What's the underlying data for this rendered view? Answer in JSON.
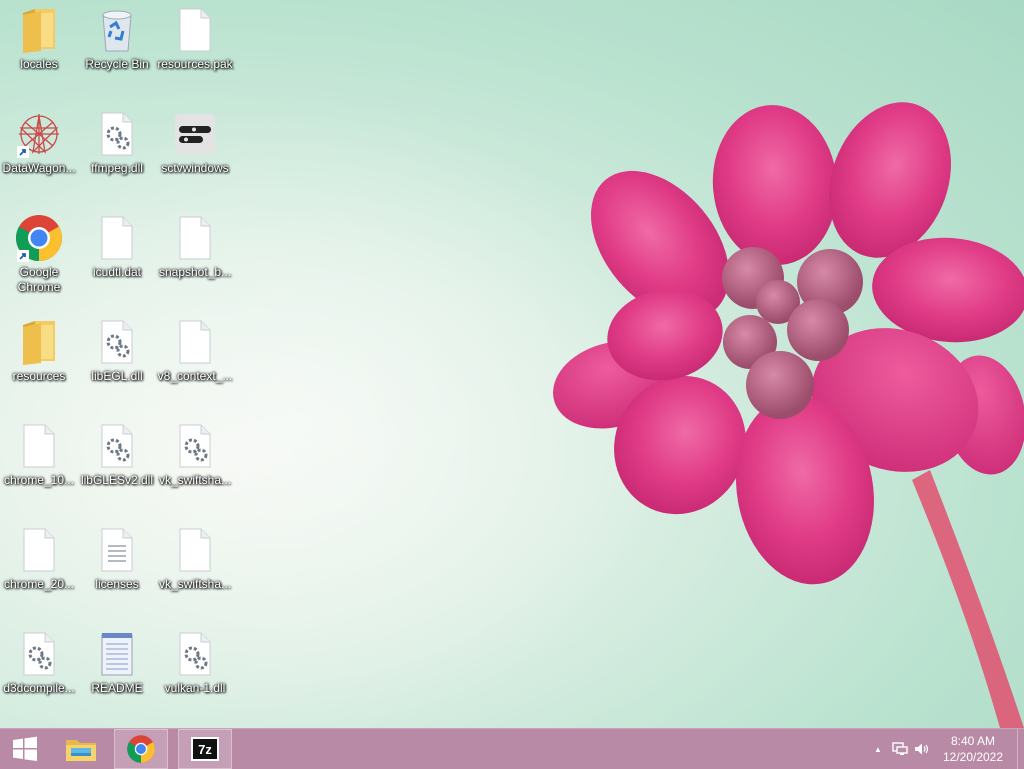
{
  "desktop": {
    "icons": [
      {
        "label": "locales",
        "type": "folder"
      },
      {
        "label": "Recycle Bin",
        "type": "recycle-bin"
      },
      {
        "label": "resources.pak",
        "type": "file"
      },
      {
        "label": "DataWagon...",
        "type": "app-shortcut"
      },
      {
        "label": "ffmpeg.dll",
        "type": "dll"
      },
      {
        "label": "sctvwindows",
        "type": "app"
      },
      {
        "label": "Google Chrome",
        "type": "chrome-shortcut"
      },
      {
        "label": "icudtl.dat",
        "type": "file"
      },
      {
        "label": "snapshot_b...",
        "type": "file"
      },
      {
        "label": "resources",
        "type": "folder"
      },
      {
        "label": "libEGL.dll",
        "type": "dll"
      },
      {
        "label": "v8_context_...",
        "type": "file"
      },
      {
        "label": "chrome_10...",
        "type": "file"
      },
      {
        "label": "libGLESv2.dll",
        "type": "dll"
      },
      {
        "label": "vk_swiftsha...",
        "type": "dll"
      },
      {
        "label": "chrome_20...",
        "type": "file"
      },
      {
        "label": "licenses",
        "type": "text-file"
      },
      {
        "label": "vk_swiftsha...",
        "type": "file"
      },
      {
        "label": "d3dcompile...",
        "type": "dll"
      },
      {
        "label": "README",
        "type": "notepad"
      },
      {
        "label": "vulkan-1.dll",
        "type": "dll"
      }
    ]
  },
  "taskbar": {
    "start_icon": "windows-logo-icon",
    "pinned": [
      {
        "name": "file-explorer",
        "icon": "file-explorer-icon"
      },
      {
        "name": "google-chrome",
        "icon": "chrome-icon"
      },
      {
        "name": "7-zip",
        "icon": "7zip-icon",
        "text": "7z"
      }
    ],
    "tray": {
      "overflow_icon": "chevron-up-icon",
      "overflow_glyph": "▲",
      "network_icon": "network-icon",
      "volume_icon": "volume-icon",
      "time": "8:40 AM",
      "date": "12/20/2022"
    }
  },
  "colors": {
    "taskbar": "#b98aa6",
    "flower": "#e03b86",
    "wallpaper": "#b9e2cf"
  }
}
